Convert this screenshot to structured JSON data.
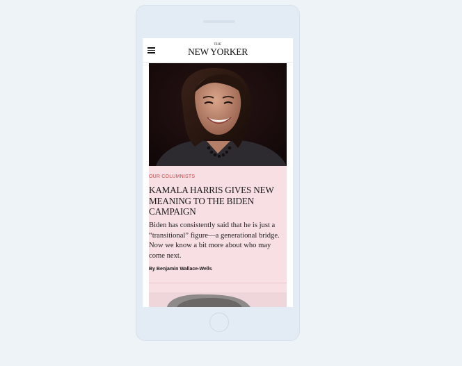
{
  "header": {
    "menu_icon": "hamburger-menu-icon",
    "logo_the": "THE",
    "logo_name": "NEW YORKER"
  },
  "article": {
    "rubric": "OUR COLUMNISTS",
    "headline_lines": [
      "KAMALA HARRIS GIVES NEW",
      "MEANING TO THE BIDEN",
      "CAMPAIGN"
    ],
    "dek_lines": [
      "Biden has consistently said that he is just a",
      "“transitional” figure—a generational bridge.",
      "Now we know a bit more about who may",
      "come next."
    ],
    "byline": "By Benjamin Wallace-Wells"
  },
  "colors": {
    "page_background": "#eef3f7",
    "phone_body": "#e3ecf5",
    "card_background": "#f7dfe3",
    "rubric_red": "#c74a4a"
  }
}
